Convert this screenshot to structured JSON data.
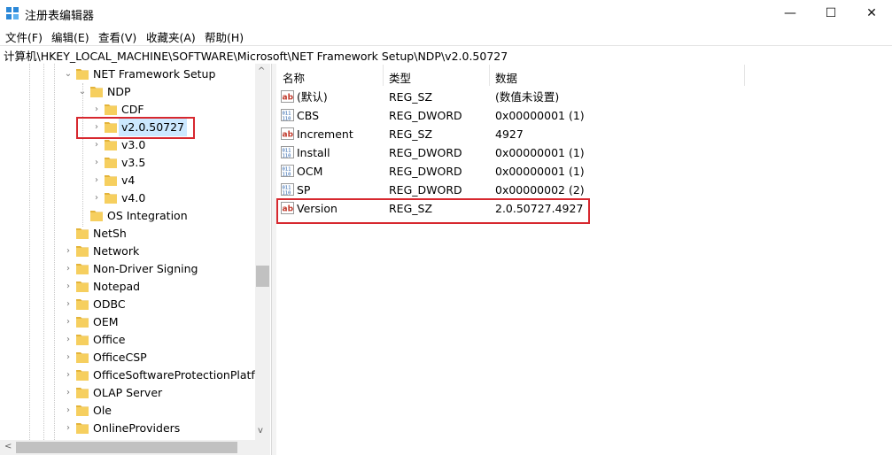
{
  "window": {
    "title": "注册表编辑器",
    "minimize_glyph": "—",
    "maximize_glyph": "☐",
    "close_glyph": "✕"
  },
  "menu": [
    "文件(F)",
    "编辑(E)",
    "查看(V)",
    "收藏夹(A)",
    "帮助(H)"
  ],
  "address": "计算机\\HKEY_LOCAL_MACHINE\\SOFTWARE\\Microsoft\\NET Framework Setup\\NDP\\v2.0.50727",
  "tree": {
    "items": [
      {
        "label": "NET Framework Setup",
        "expander": "⌄"
      },
      {
        "label": "NDP",
        "expander": "⌄"
      },
      {
        "label": "CDF",
        "expander": "›"
      },
      {
        "label": "v2.0.50727",
        "expander": "›",
        "selected": true
      },
      {
        "label": "v3.0",
        "expander": "›"
      },
      {
        "label": "v3.5",
        "expander": "›"
      },
      {
        "label": "v4",
        "expander": "›"
      },
      {
        "label": "v4.0",
        "expander": "›"
      },
      {
        "label": "OS Integration",
        "expander": ""
      },
      {
        "label": "NetSh",
        "expander": ""
      },
      {
        "label": "Network",
        "expander": "›"
      },
      {
        "label": "Non-Driver Signing",
        "expander": "›"
      },
      {
        "label": "Notepad",
        "expander": "›"
      },
      {
        "label": "ODBC",
        "expander": "›"
      },
      {
        "label": "OEM",
        "expander": "›"
      },
      {
        "label": "Office",
        "expander": "›"
      },
      {
        "label": "OfficeCSP",
        "expander": "›"
      },
      {
        "label": "OfficeSoftwareProtectionPlatfor",
        "expander": "›"
      },
      {
        "label": "OLAP Server",
        "expander": "›"
      },
      {
        "label": "Ole",
        "expander": "›"
      },
      {
        "label": "OnlineProviders",
        "expander": "›"
      }
    ],
    "scroll_up": "^",
    "scroll_down": "v",
    "scroll_left": "<"
  },
  "list": {
    "headers": {
      "name": "名称",
      "type": "类型",
      "data": "数据"
    },
    "rows": [
      {
        "name": "(默认)",
        "type": "REG_SZ",
        "data": "(数值未设置)",
        "icon": "ab"
      },
      {
        "name": "CBS",
        "type": "REG_DWORD",
        "data": "0x00000001 (1)",
        "icon": "bin"
      },
      {
        "name": "Increment",
        "type": "REG_SZ",
        "data": "4927",
        "icon": "ab"
      },
      {
        "name": "Install",
        "type": "REG_DWORD",
        "data": "0x00000001 (1)",
        "icon": "bin"
      },
      {
        "name": "OCM",
        "type": "REG_DWORD",
        "data": "0x00000001 (1)",
        "icon": "bin"
      },
      {
        "name": "SP",
        "type": "REG_DWORD",
        "data": "0x00000002 (2)",
        "icon": "bin"
      },
      {
        "name": "Version",
        "type": "REG_SZ",
        "data": "2.0.50727.4927",
        "icon": "ab"
      }
    ]
  },
  "colors": {
    "folder": "#f6cf5f",
    "folder_dark": "#e4b43a",
    "highlight": "#d7282f",
    "selected_bg": "#cce8ff"
  }
}
